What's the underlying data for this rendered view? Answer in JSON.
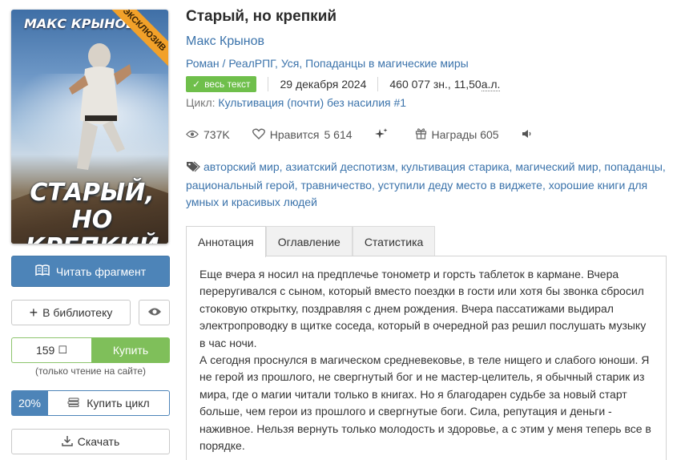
{
  "cover": {
    "author_text": "МАКС КРЫНОВ",
    "title_line1": "СТАРЫЙ,",
    "title_line2": "НО КРЕПКИЙ",
    "ribbon": "ЭКСКЛЮЗИВ"
  },
  "actions": {
    "read_fragment": "Читать фрагмент",
    "add_to_library": "В библиотеку",
    "price": "159",
    "currency_symbol": "☐",
    "buy": "Купить",
    "buy_note": "(только чтение на сайте)",
    "cycle_discount": "20%",
    "buy_cycle": "Купить цикл",
    "download": "Скачать"
  },
  "book": {
    "title": "Старый, но крепкий",
    "author": "Макс Крынов",
    "genres": "Роман / РеалРПГ, Уся, Попаданцы в магические миры",
    "status_badge": "весь текст",
    "date": "29 декабря 2024",
    "size": "460 077 зн., 11,50 ",
    "size_unit": "а.л.",
    "cycle_prefix": "Цикл: ",
    "cycle_link": "Культивация (почти) без насилия #1"
  },
  "stats": {
    "views": "737K",
    "likes_label": "Нравится",
    "likes_count": "5 614",
    "awards": "Награды 605"
  },
  "tags": "авторский мир, азиатский деспотизм, культивация старика, магический мир, попаданцы, рациональный герой, травничество, уступили деду место в виджете, хорошие книги для умных и красивых людей",
  "tabs": [
    "Аннотация",
    "Оглавление",
    "Статистика"
  ],
  "annotation": [
    "Еще вчера я носил на предплечье тонометр и горсть таблеток в кармане. Вчера переругивался с сыном, который вместо поездки в гости или хотя бы звонка сбросил стоковую открытку, поздравляя с днем рождения. Вчера пассатижами выдирал электропроводку в щитке соседа, который в очередной раз решил послушать музыку в час ночи.",
    "А сегодня проснулся в магическом средневековье, в теле нищего и слабого юноши. Я не герой из прошлого, не свергнутый бог и не мастер-целитель, я обычный старик из мира, где о магии читали только в книгах. Но я благодарен судьбе за новый старт больше, чем герои из прошлого и свергнутые боги. Сила, репутация и деньги - наживное. Нельзя вернуть только молодость и здоровье, а с этим у меня теперь все в порядке."
  ]
}
